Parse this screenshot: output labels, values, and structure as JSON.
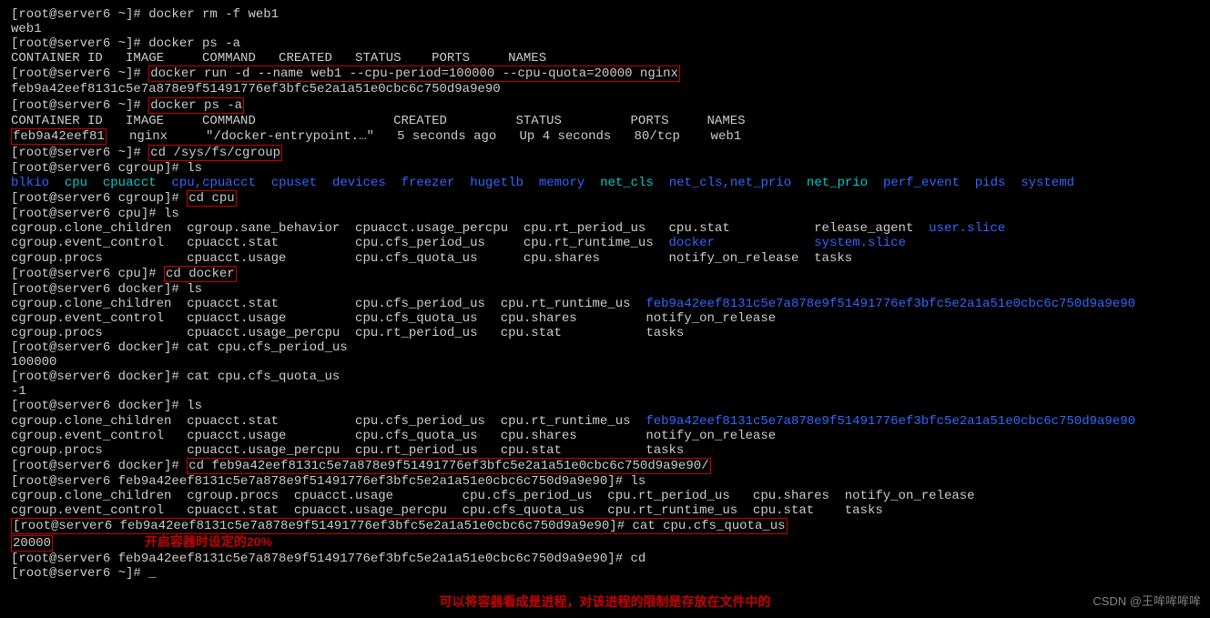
{
  "l1": "[root@server6 ~]# docker rm -f web1",
  "l2": "web1",
  "l3": "[root@server6 ~]# docker ps -a",
  "l4": "CONTAINER ID   IMAGE     COMMAND   CREATED   STATUS    PORTS     NAMES",
  "l5a": "[root@server6 ~]# ",
  "l5b": "docker run -d --name web1 --cpu-period=100000 --cpu-quota=20000 nginx",
  "l6": "feb9a42eef8131c5e7a878e9f51491776ef3bfc5e2a1a51e0cbc6c750d9a9e90",
  "l7a": "[root@server6 ~]# ",
  "l7b": "docker ps -a",
  "l8": "CONTAINER ID   IMAGE     COMMAND                  CREATED         STATUS         PORTS     NAMES",
  "l9a": "feb9a42eef81",
  "l9b": "   nginx     \"/docker-entrypoint.…\"   5 seconds ago   Up 4 seconds   80/tcp    web1",
  "l10a": "[root@server6 ~]# ",
  "l10b": "cd /sys/fs/cgroup",
  "l11": "[root@server6 cgroup]# ls",
  "cg": {
    "blkio": "blkio",
    "cpu": "cpu",
    "cpuacct": "cpuacct",
    "cpu_cpuacct": "cpu,cpuacct",
    "cpuset": "cpuset",
    "devices": "devices",
    "freezer": "freezer",
    "hugetlb": "hugetlb",
    "memory": "memory",
    "net_cls": "net_cls",
    "net_cls_prio": "net_cls,net_prio",
    "net_prio": "net_prio",
    "perf_event": "perf_event",
    "pids": "pids",
    "systemd": "systemd"
  },
  "l13a": "[root@server6 cgroup]# ",
  "l13b": "cd cpu",
  "l14": "[root@server6 cpu]# ls",
  "l15": "cgroup.clone_children  cgroup.sane_behavior  cpuacct.usage_percpu  cpu.rt_period_us   cpu.stat           release_agent  ",
  "l15user": "user.slice",
  "l16": "cgroup.event_control   cpuacct.stat          cpu.cfs_period_us     cpu.rt_runtime_us  ",
  "l16docker": "docker",
  "l16gap": "             ",
  "l16sys": "system.slice",
  "l17": "cgroup.procs           cpuacct.usage         cpu.cfs_quota_us      cpu.shares         notify_on_release  tasks",
  "l18a": "[root@server6 cpu]# ",
  "l18b": "cd docker",
  "l19": "[root@server6 docker]# ls",
  "l20": "cgroup.clone_children  cpuacct.stat          cpu.cfs_period_us  cpu.rt_runtime_us  ",
  "l20hash": "feb9a42eef8131c5e7a878e9f51491776ef3bfc5e2a1a51e0cbc6c750d9a9e90",
  "l21": "cgroup.event_control   cpuacct.usage         cpu.cfs_quota_us   cpu.shares         notify_on_release",
  "l22": "cgroup.procs           cpuacct.usage_percpu  cpu.rt_period_us   cpu.stat           tasks",
  "l23": "[root@server6 docker]# cat cpu.cfs_period_us",
  "l24": "100000",
  "l25": "[root@server6 docker]# cat cpu.cfs_quota_us",
  "l26": "-1",
  "l27": "[root@server6 docker]# ls",
  "l28": "cgroup.clone_children  cpuacct.stat          cpu.cfs_period_us  cpu.rt_runtime_us  ",
  "l28hash": "feb9a42eef8131c5e7a878e9f51491776ef3bfc5e2a1a51e0cbc6c750d9a9e90",
  "l29": "cgroup.event_control   cpuacct.usage         cpu.cfs_quota_us   cpu.shares         notify_on_release",
  "l30": "cgroup.procs           cpuacct.usage_percpu  cpu.rt_period_us   cpu.stat           tasks",
  "l31a": "[root@server6 docker]# ",
  "l31b": "cd feb9a42eef8131c5e7a878e9f51491776ef3bfc5e2a1a51e0cbc6c750d9a9e90/",
  "l32": "[root@server6 feb9a42eef8131c5e7a878e9f51491776ef3bfc5e2a1a51e0cbc6c750d9a9e90]# ls",
  "l33": "cgroup.clone_children  cgroup.procs  cpuacct.usage         cpu.cfs_period_us  cpu.rt_period_us   cpu.shares  notify_on_release",
  "l34": "cgroup.event_control   cpuacct.stat  cpuacct.usage_percpu  cpu.cfs_quota_us   cpu.rt_runtime_us  cpu.stat    tasks",
  "l35a": "[root@server6 feb9a42eef8131c5e7a878e9f51491776ef3bfc5e2a1a51e0cbc6c750d9a9e90]# ",
  "l35b": "cat cpu.cfs_quota_us",
  "l36a": "20000",
  "l36gap": "            ",
  "l36ann": "开启容器时设定的20%",
  "l37": "[root@server6 feb9a42eef8131c5e7a878e9f51491776ef3bfc5e2a1a51e0cbc6c750d9a9e90]# cd",
  "l38": "[root@server6 ~]# _",
  "bottom_ann": "可以将容器看成是进程，对该进程的限制是存放在文件中的",
  "watermark": "CSDN @王哞哞哞哞"
}
